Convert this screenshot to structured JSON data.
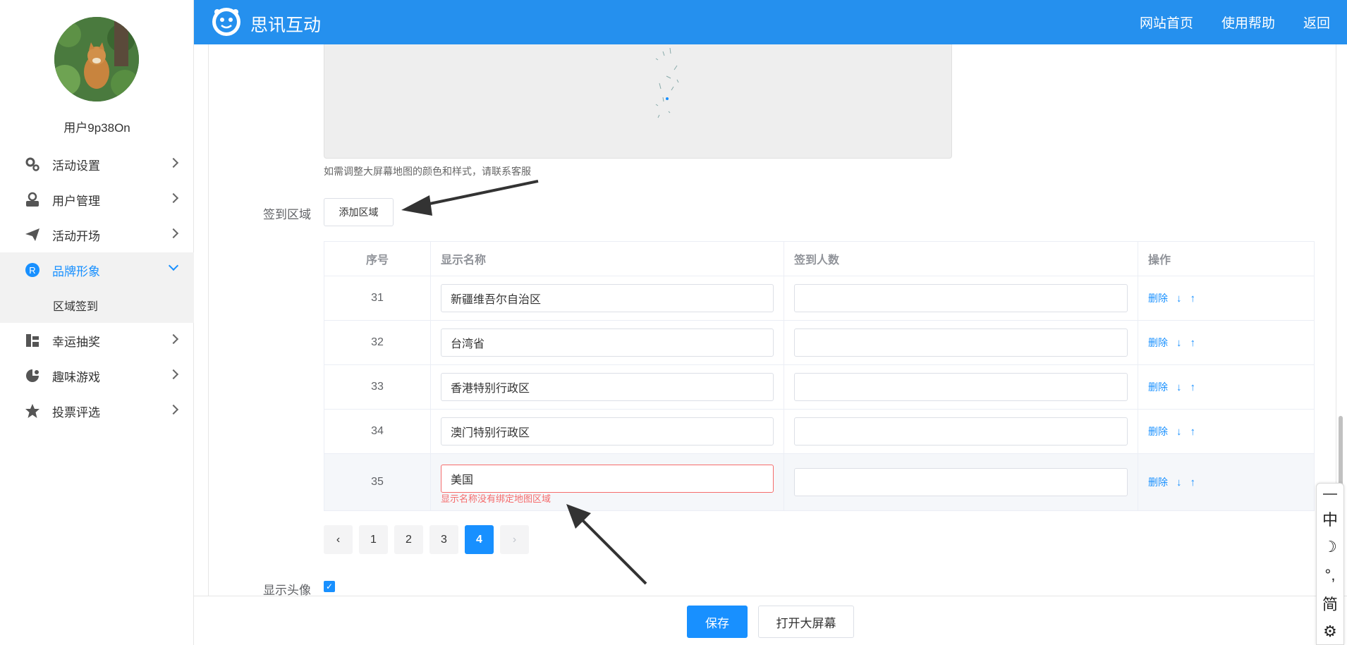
{
  "header": {
    "brand": "思讯互动",
    "nav": [
      "网站首页",
      "使用帮助",
      "返回"
    ]
  },
  "sidebar": {
    "username": "用户9p38On",
    "items": [
      {
        "label": "活动设置",
        "icon": "gear-icon"
      },
      {
        "label": "用户管理",
        "icon": "user-icon"
      },
      {
        "label": "活动开场",
        "icon": "paper-plane-icon"
      },
      {
        "label": "品牌形象",
        "icon": "brand-r-icon"
      },
      {
        "label": "幸运抽奖",
        "icon": "lottery-icon"
      },
      {
        "label": "趣味游戏",
        "icon": "game-icon"
      },
      {
        "label": "投票评选",
        "icon": "star-icon"
      }
    ],
    "sub_item": "区域签到"
  },
  "main": {
    "map_note": "如需调整大屏幕地图的颜色和样式，请联系客服",
    "signin_label": "签到区域",
    "add_button": "添加区域",
    "table": {
      "headers": [
        "序号",
        "显示名称",
        "签到人数",
        "操作"
      ],
      "rows": [
        {
          "no": "31",
          "name": "新疆维吾尔自治区",
          "count": ""
        },
        {
          "no": "32",
          "name": "台湾省",
          "count": ""
        },
        {
          "no": "33",
          "name": "香港特别行政区",
          "count": ""
        },
        {
          "no": "34",
          "name": "澳门特别行政区",
          "count": ""
        },
        {
          "no": "35",
          "name": "美国",
          "count": "",
          "error": "显示名称没有绑定地图区域"
        }
      ],
      "delete_label": "删除",
      "down_arrow": "↓",
      "up_arrow": "↑"
    },
    "pagination": {
      "prev": "‹",
      "pages": [
        "1",
        "2",
        "3",
        "4"
      ],
      "current": "4",
      "next": "›"
    },
    "avatar_label": "显示头像",
    "avatar_checked": true
  },
  "footer": {
    "save": "保存",
    "open_screen": "打开大屏幕"
  },
  "ime": {
    "items": [
      "中",
      "☽",
      "°,",
      "简",
      "⚙"
    ]
  },
  "colors": {
    "header": "#2590ee",
    "accent": "#1890ff",
    "error": "#f56c6c"
  }
}
